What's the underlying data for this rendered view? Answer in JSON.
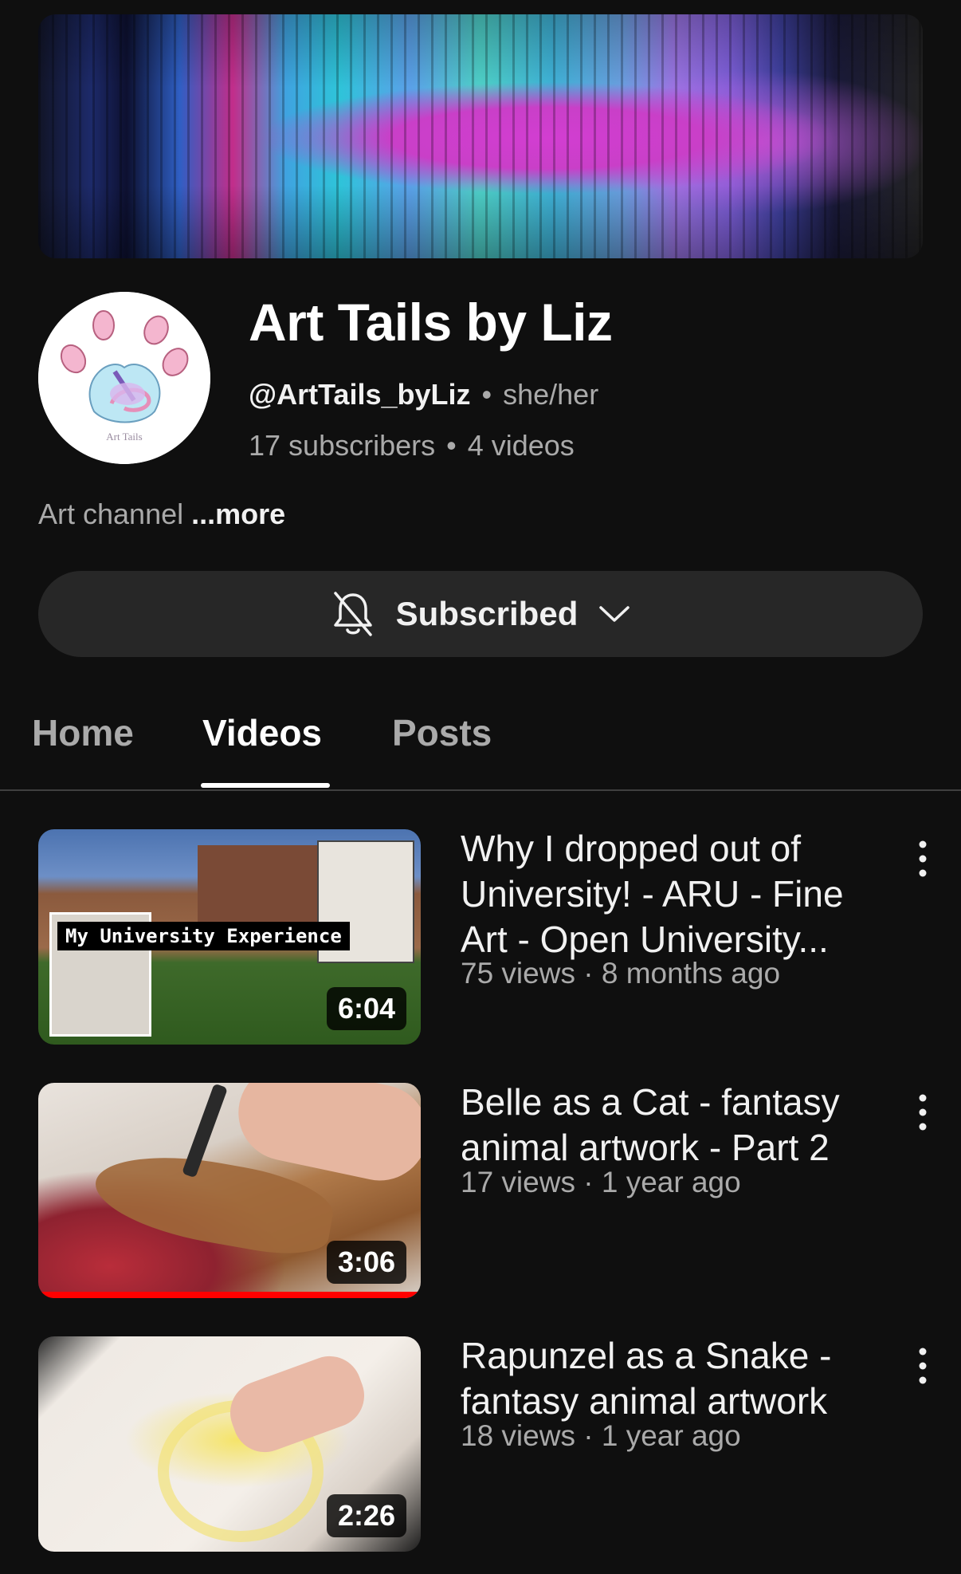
{
  "channel": {
    "name": "Art Tails by Liz",
    "handle": "@ArtTails_byLiz",
    "pronouns": "she/her",
    "subscribers": "17 subscribers",
    "videos_count": "4 videos",
    "about": "Art channel",
    "more_label": "...more",
    "avatar_text": "Art Tails"
  },
  "subscribe": {
    "label": "Subscribed",
    "icon": "bell-off-icon",
    "chevron": "chevron-down-icon"
  },
  "tabs": [
    {
      "label": "Home",
      "active": false
    },
    {
      "label": "Videos",
      "active": true
    },
    {
      "label": "Posts",
      "active": false
    }
  ],
  "videos": [
    {
      "title": "Why I dropped out of University! - ARU - Fine Art - Open University...",
      "meta": "75 views · 8 months ago",
      "duration": "6:04",
      "overlay_text": "My University Experience",
      "watched_fraction": 0
    },
    {
      "title": "Belle as a Cat - fantasy animal artwork - Part 2",
      "meta": "17 views · 1 year ago",
      "duration": "3:06",
      "watched_fraction": 1
    },
    {
      "title": "Rapunzel as a Snake - fantasy animal artwork",
      "meta": "18 views · 1 year ago",
      "duration": "2:26",
      "watched_fraction": 0
    }
  ],
  "colors": {
    "background": "#0f0f0f",
    "secondary_text": "#aaaaaa",
    "progress": "#ff0000"
  }
}
